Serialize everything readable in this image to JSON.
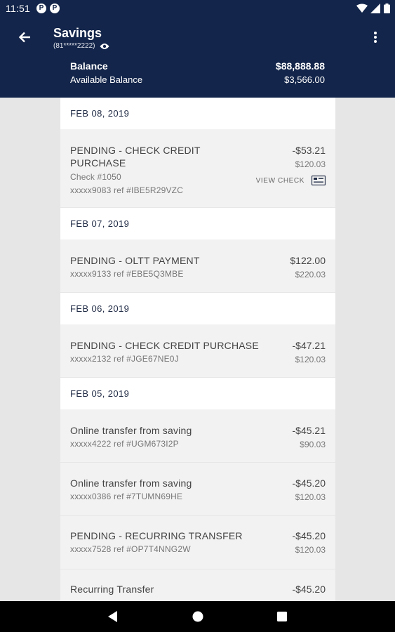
{
  "status_bar": {
    "time": "11:51",
    "badges": [
      "P",
      "P"
    ],
    "icons": [
      "wifi-icon",
      "signal-icon",
      "battery-icon"
    ]
  },
  "header": {
    "title": "Savings",
    "account_number": "(81*****2222)",
    "balance_label": "Balance",
    "balance_value": "$88,888.88",
    "available_label": "Available Balance",
    "available_value": "$3,566.00"
  },
  "groups": [
    {
      "date": "FEB 08, 2019",
      "transactions": [
        {
          "title_line1": "PENDING - CHECK CREDIT",
          "title_line2": "PURCHASE",
          "detail": "Check #1050",
          "ref": "xxxxx9083 ref #IBE5R29VZC",
          "amount": "-$53.21",
          "balance": "$120.03",
          "action": "VIEW CHECK"
        }
      ]
    },
    {
      "date": "FEB 07, 2019",
      "transactions": [
        {
          "title": "PENDING - OLTT PAYMENT",
          "ref": "xxxxx9133 ref #EBE5Q3MBE",
          "amount": "$122.00",
          "balance": "$220.03"
        }
      ]
    },
    {
      "date": "FEB 06, 2019",
      "transactions": [
        {
          "title": "PENDING - CHECK CREDIT PURCHASE",
          "ref": "xxxxx2132 ref #JGE67NE0J",
          "amount": "-$47.21",
          "balance": "$120.03"
        }
      ]
    },
    {
      "date": "FEB 05, 2019",
      "transactions": [
        {
          "title": "Online transfer from saving",
          "ref": "xxxxx4222 ref #UGM673I2P",
          "amount": "-$45.21",
          "balance": "$90.03"
        },
        {
          "title": "Online transfer from saving",
          "ref": "xxxxx0386 ref #7TUMN69HE",
          "amount": "-$45.20",
          "balance": "$120.03"
        },
        {
          "title": "PENDING - RECURRING TRANSFER",
          "ref": "xxxxx7528 ref #OP7T4NNG2W",
          "amount": "-$45.20",
          "balance": "$120.03"
        },
        {
          "title": "Recurring Transfer",
          "amount": "-$45.20"
        }
      ]
    }
  ],
  "colors": {
    "header_bg": "#13254a",
    "list_bg": "#f2f2f2",
    "page_bg": "#e6e6e6"
  }
}
